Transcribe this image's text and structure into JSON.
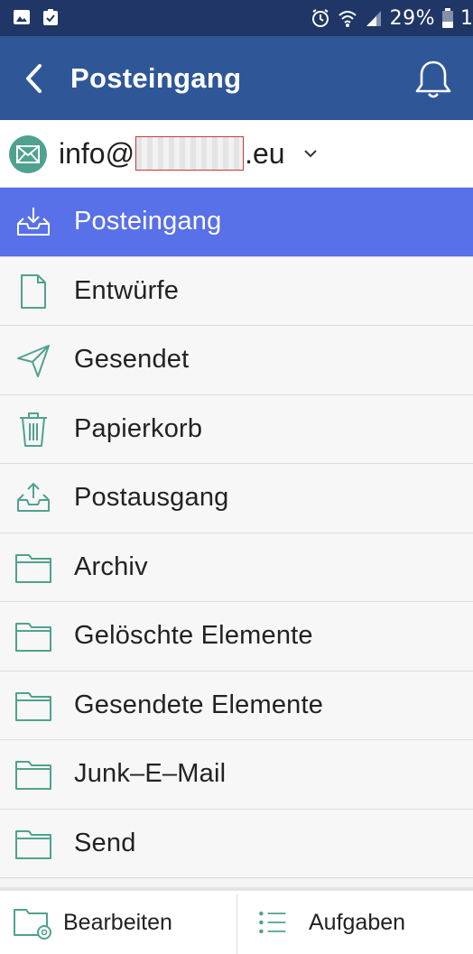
{
  "status_bar": {
    "battery_percent": "29%",
    "overflow_digit": "1",
    "icons": [
      "image-icon",
      "clipboard-check-icon",
      "alarm-icon",
      "wifi-icon",
      "signal-icon",
      "battery-icon"
    ]
  },
  "header": {
    "title": "Posteingang",
    "back_icon": "back-arrow-icon",
    "bell_icon": "bell-icon"
  },
  "account": {
    "email_prefix": "info@",
    "email_suffix": ".eu",
    "icon": "mail-icon"
  },
  "folders": [
    {
      "label": "Posteingang",
      "icon": "inbox-icon",
      "selected": true
    },
    {
      "label": "Entwürfe",
      "icon": "document-icon",
      "selected": false
    },
    {
      "label": "Gesendet",
      "icon": "send-icon",
      "selected": false
    },
    {
      "label": "Papierkorb",
      "icon": "trash-icon",
      "selected": false
    },
    {
      "label": "Postausgang",
      "icon": "outbox-icon",
      "selected": false
    },
    {
      "label": "Archiv",
      "icon": "folder-icon",
      "selected": false
    },
    {
      "label": "Gelöschte Elemente",
      "icon": "folder-icon",
      "selected": false
    },
    {
      "label": "Gesendete Elemente",
      "icon": "folder-icon",
      "selected": false
    },
    {
      "label": "Junk–E–Mail",
      "icon": "folder-icon",
      "selected": false
    },
    {
      "label": "Send",
      "icon": "folder-icon",
      "selected": false
    }
  ],
  "bottom_bar": {
    "edit_label": "Bearbeiten",
    "tasks_label": "Aufgaben"
  },
  "colors": {
    "status_bar": "#1f3666",
    "header": "#2f5798",
    "selected_row": "#5870e8",
    "icon_teal": "#4fa28f"
  }
}
